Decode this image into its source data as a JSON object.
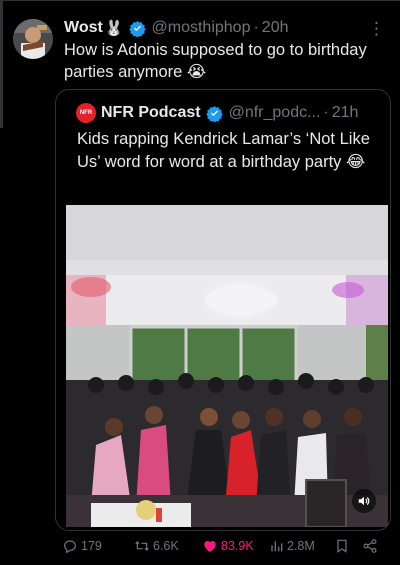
{
  "tweet": {
    "author_name": "Wost",
    "author_emoji": "🐰",
    "handle": "@mosthiphop",
    "separator": "·",
    "time": "20h",
    "text": "How is Adonis supposed to go to birthday parties anymore 😭",
    "more_icon": "more-vertical-icon"
  },
  "quoted": {
    "logo_text": "NFR",
    "author_name": "NFR Podcast",
    "handle": "@nfr_podc...",
    "separator": "·",
    "time": "21h",
    "text": "Kids rapping Kendrick Lamar’s ‘Not Like Us’ word for word at a birthday party 😂",
    "media": {
      "type": "video",
      "volume_icon": "volume-icon"
    }
  },
  "actions": {
    "replies": "179",
    "reposts": "6.6K",
    "likes": "83.9K",
    "views": "2.8M"
  },
  "colors": {
    "background": "#000000",
    "text": "#e7e9ea",
    "muted": "#71767b",
    "border": "#2f3336",
    "verified": "#1d9bf0",
    "like": "#f91880"
  }
}
